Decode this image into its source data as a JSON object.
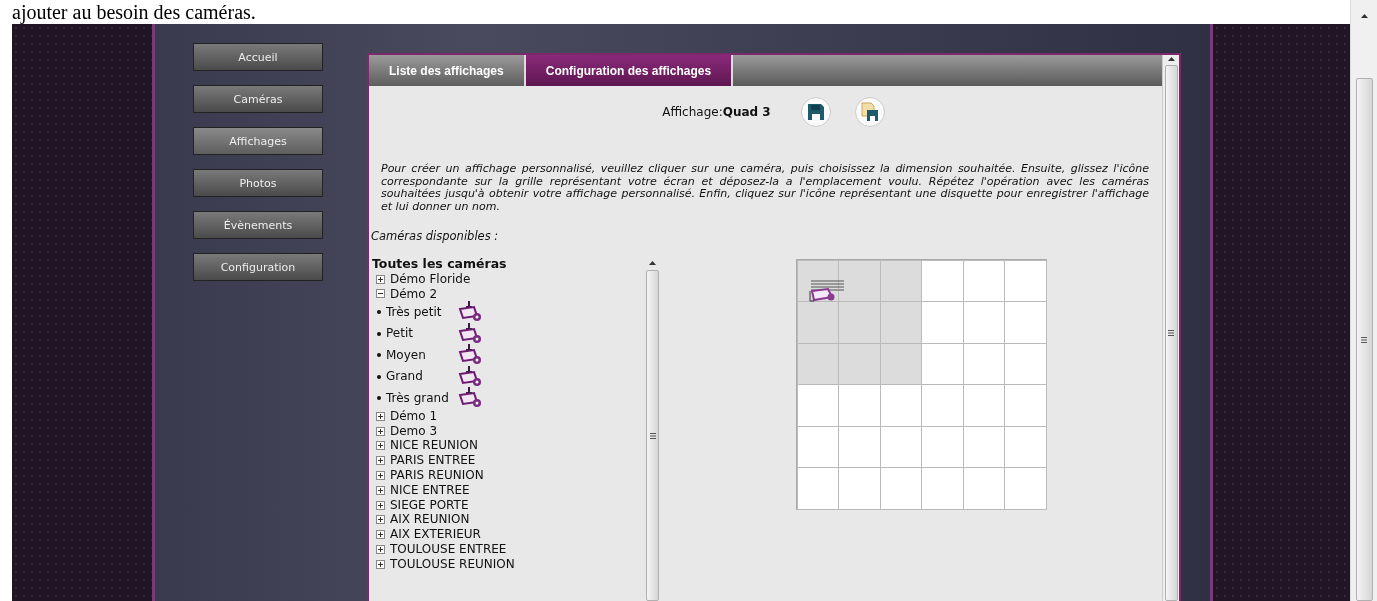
{
  "page_caption": "ajouter au besoin des caméras.",
  "nav": [
    {
      "label": "Accueil",
      "selected": false
    },
    {
      "label": "Caméras",
      "selected": false
    },
    {
      "label": "Affichages",
      "selected": true
    },
    {
      "label": "Photos",
      "selected": false
    },
    {
      "label": "Évènements",
      "selected": false
    },
    {
      "label": "Configuration",
      "selected": false
    }
  ],
  "tabs": [
    {
      "label": "Liste des affichages",
      "selected": false
    },
    {
      "label": "Configuration des affichages",
      "selected": true
    }
  ],
  "display": {
    "label": "Affichage:",
    "name": "Quad 3"
  },
  "instructions": "Pour créer un affichage personnalisé, veuillez cliquer sur une caméra, puis choisissez la dimension souhaitée. Ensuite, glissez l'icône correspondante sur la grille représentant votre écran et déposez-la a l'emplacement voulu. Répétez l'opération avec les caméras souhaitées jusqu'à obtenir votre affichage personnalisé. Enfin, cliquez sur l'icône représentant une disquette pour enregistrer l'affichage et lui donner un nom.",
  "cameras_label": "Caméras disponibles :",
  "tree": {
    "label": "Toutes les caméras",
    "children": [
      {
        "label": "Démo Floride",
        "expanded": false
      },
      {
        "label": "Démo 2",
        "expanded": true,
        "children": [
          {
            "label": "Très petit"
          },
          {
            "label": "Petit"
          },
          {
            "label": "Moyen"
          },
          {
            "label": "Grand"
          },
          {
            "label": "Très grand"
          }
        ]
      },
      {
        "label": "Démo 1",
        "expanded": false
      },
      {
        "label": "Demo 3",
        "expanded": false
      },
      {
        "label": "NICE REUNION",
        "expanded": false
      },
      {
        "label": "PARIS ENTREE",
        "expanded": false
      },
      {
        "label": "PARIS REUNION",
        "expanded": false
      },
      {
        "label": "NICE ENTREE",
        "expanded": false
      },
      {
        "label": "SIEGE PORTE",
        "expanded": false
      },
      {
        "label": "AIX REUNION",
        "expanded": false
      },
      {
        "label": "AIX EXTERIEUR",
        "expanded": false
      },
      {
        "label": "TOULOUSE ENTREE",
        "expanded": false
      },
      {
        "label": "TOULOUSE REUNION",
        "expanded": false
      }
    ]
  },
  "grid": {
    "rows": [
      [
        {
          "selected": true,
          "camera": true
        },
        {
          "selected": true,
          "camera": false
        },
        {
          "selected": true,
          "camera": false
        },
        {
          "selected": false,
          "camera": false
        },
        {
          "selected": false,
          "camera": false
        },
        {
          "selected": false,
          "camera": false
        }
      ],
      [
        {
          "selected": true,
          "camera": false
        },
        {
          "selected": true,
          "camera": false
        },
        {
          "selected": true,
          "camera": false
        },
        {
          "selected": false,
          "camera": false
        },
        {
          "selected": false,
          "camera": false
        },
        {
          "selected": false,
          "camera": false
        }
      ],
      [
        {
          "selected": true,
          "camera": false
        },
        {
          "selected": true,
          "camera": false
        },
        {
          "selected": true,
          "camera": false
        },
        {
          "selected": false,
          "camera": false
        },
        {
          "selected": false,
          "camera": false
        },
        {
          "selected": false,
          "camera": false
        }
      ],
      [
        {
          "selected": false,
          "camera": false
        },
        {
          "selected": false,
          "camera": false
        },
        {
          "selected": false,
          "camera": false
        },
        {
          "selected": false,
          "camera": false
        },
        {
          "selected": false,
          "camera": false
        },
        {
          "selected": false,
          "camera": false
        }
      ],
      [
        {
          "selected": false,
          "camera": false
        },
        {
          "selected": false,
          "camera": false
        },
        {
          "selected": false,
          "camera": false
        },
        {
          "selected": false,
          "camera": false
        },
        {
          "selected": false,
          "camera": false
        },
        {
          "selected": false,
          "camera": false
        }
      ],
      [
        {
          "selected": false,
          "camera": false
        },
        {
          "selected": false,
          "camera": false
        },
        {
          "selected": false,
          "camera": false
        },
        {
          "selected": false,
          "camera": false
        },
        {
          "selected": false,
          "camera": false
        },
        {
          "selected": false,
          "camera": false
        }
      ]
    ]
  }
}
